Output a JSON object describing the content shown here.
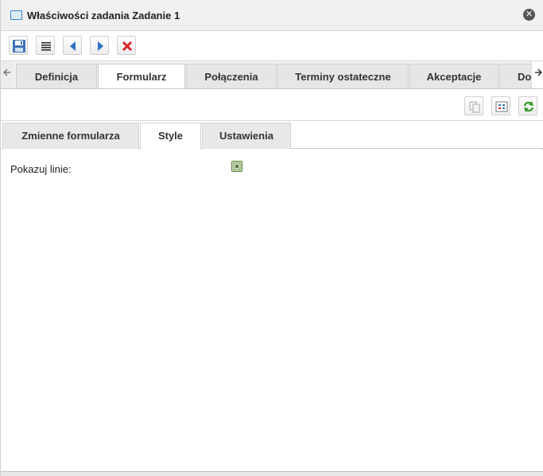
{
  "window": {
    "title": "Właściwości zadania Zadanie 1",
    "title_icon": "window-icon",
    "close_icon": "close-icon"
  },
  "toolbar": {
    "buttons": [
      {
        "name": "save-button",
        "icon": "floppy-icon"
      },
      {
        "name": "properties-button",
        "icon": "text-lines-icon"
      },
      {
        "name": "previous-button",
        "icon": "arrow-left-icon"
      },
      {
        "name": "next-button",
        "icon": "arrow-right-icon"
      },
      {
        "name": "delete-button",
        "icon": "red-x-icon"
      }
    ]
  },
  "main_tabs": {
    "items": [
      "Definicja",
      "Formularz",
      "Połączenia",
      "Terminy ostateczne",
      "Akceptacje",
      "Do"
    ],
    "active": "Formularz"
  },
  "subtoolbar": {
    "buttons": [
      {
        "name": "copy-button",
        "icon": "copy-icon"
      },
      {
        "name": "layout-button",
        "icon": "grid-icon"
      },
      {
        "name": "refresh-button",
        "icon": "refresh-icon"
      }
    ]
  },
  "sub_tabs": {
    "items": [
      "Zmienne formularza",
      "Style",
      "Ustawienia"
    ],
    "active": "Style"
  },
  "form": {
    "show_lines_label": "Pokazuj linie:",
    "show_lines_checked": true
  },
  "colors": {
    "accent_blue": "#3a87c8",
    "delete_red": "#d9262b",
    "refresh_green": "#3a9a2c",
    "checkbox_green": "#5b7d3a"
  }
}
